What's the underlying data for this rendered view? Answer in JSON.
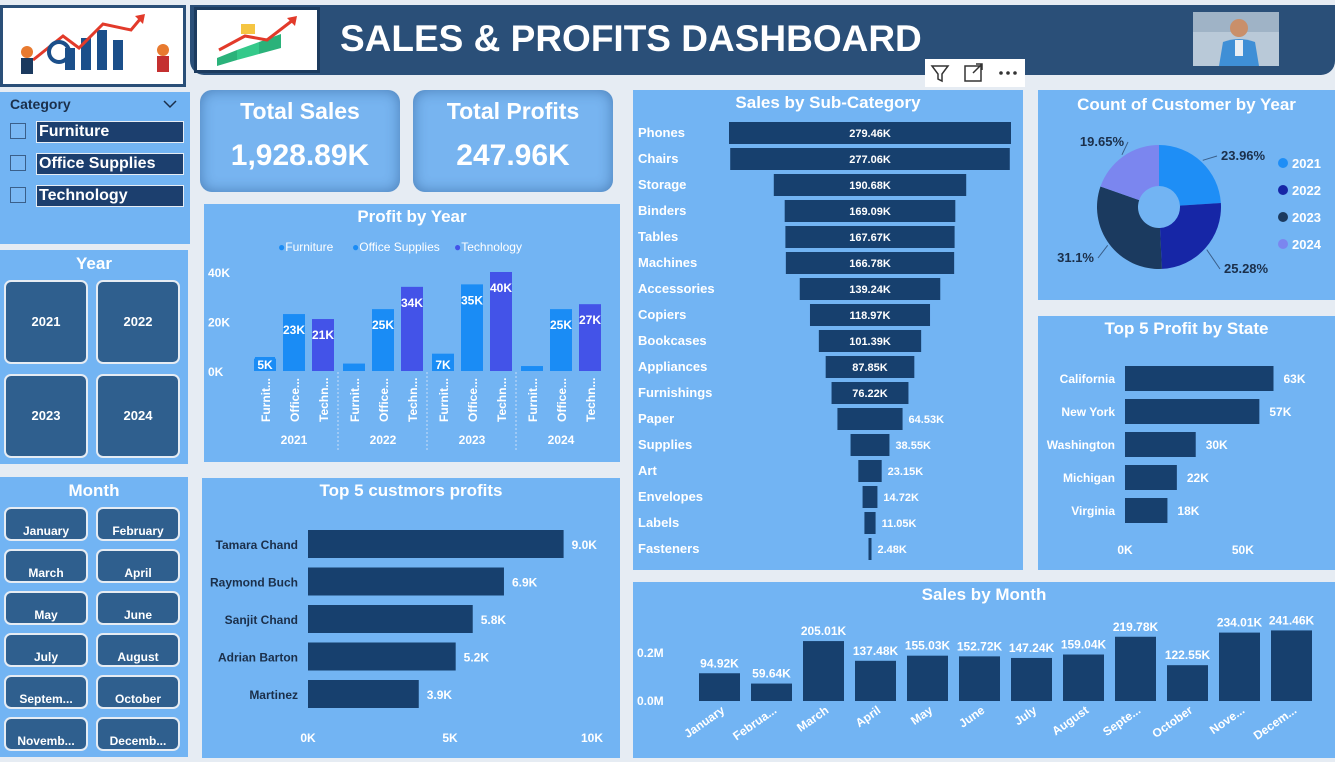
{
  "header": {
    "title": "SALES & PROFITS DASHBOARD"
  },
  "toolbar": {
    "filter_icon": "filter-icon",
    "focus_icon": "focus-mode-icon",
    "more_icon": "more-options-icon"
  },
  "category_slicer": {
    "title": "Category",
    "items": [
      "Furniture",
      "Office Supplies",
      "Technology"
    ]
  },
  "year_slicer": {
    "title": "Year",
    "items": [
      "2021",
      "2022",
      "2023",
      "2024"
    ]
  },
  "month_slicer": {
    "title": "Month",
    "items": [
      "January",
      "February",
      "March",
      "April",
      "May",
      "June",
      "July",
      "August",
      "Septem...",
      "October",
      "Novemb...",
      "Decemb..."
    ]
  },
  "kpis": {
    "total_sales_label": "Total Sales",
    "total_sales_value": "1,928.89K",
    "total_profits_label": "Total Profits",
    "total_profits_value": "247.96K"
  },
  "colors": {
    "panel_bg": "#72b4f3",
    "header_bg": "#2a4f78",
    "dark_bar": "#17406e",
    "furniture": "#1a8cf5",
    "office_supplies": "#1a8cf5",
    "technology": "#4353e8",
    "pie_2021": "#1e8ef6",
    "pie_2022": "#1626a6",
    "pie_2023": "#1b3a5f",
    "pie_2024": "#7b86ef"
  },
  "chart_data": [
    {
      "id": "profit_by_year",
      "type": "bar",
      "title": "Profit by Year",
      "legend": [
        "Furniture",
        "Office Supplies",
        "Technology"
      ],
      "legend_position": "top",
      "groups": [
        "2021",
        "2022",
        "2023",
        "2024"
      ],
      "categories": [
        "Furnit...",
        "Office...",
        "Techn..."
      ],
      "series": [
        {
          "name": "Furniture",
          "values": [
            5000,
            3000,
            7000,
            2000
          ],
          "labels": [
            "5K",
            "",
            "7K",
            ""
          ]
        },
        {
          "name": "Office Supplies",
          "values": [
            23000,
            25000,
            35000,
            25000
          ],
          "labels": [
            "23K",
            "25K",
            "35K",
            "25K"
          ]
        },
        {
          "name": "Technology",
          "values": [
            21000,
            34000,
            40000,
            27000
          ],
          "labels": [
            "21K",
            "34K",
            "40K",
            "27K"
          ]
        }
      ],
      "yticks": [
        "0K",
        "20K",
        "40K"
      ],
      "ylim": [
        0,
        40000
      ]
    },
    {
      "id": "sales_by_subcategory",
      "type": "bar",
      "title": "Sales by Sub-Category",
      "categories": [
        "Phones",
        "Chairs",
        "Storage",
        "Binders",
        "Tables",
        "Machines",
        "Accessories",
        "Copiers",
        "Bookcases",
        "Appliances",
        "Furnishings",
        "Paper",
        "Supplies",
        "Art",
        "Envelopes",
        "Labels",
        "Fasteners"
      ],
      "values": [
        279.46,
        277.06,
        190.68,
        169.09,
        167.67,
        166.78,
        139.24,
        118.97,
        101.39,
        87.85,
        76.22,
        64.53,
        38.55,
        23.15,
        14.72,
        11.05,
        2.48
      ],
      "labels": [
        "279.46K",
        "277.06K",
        "190.68K",
        "169.09K",
        "167.67K",
        "166.78K",
        "139.24K",
        "118.97K",
        "101.39K",
        "87.85K",
        "76.22K",
        "64.53K",
        "38.55K",
        "23.15K",
        "14.72K",
        "11.05K",
        "2.48K"
      ]
    },
    {
      "id": "customer_count_by_year",
      "type": "pie",
      "title": "Count of Customer by Year",
      "categories": [
        "2021",
        "2022",
        "2023",
        "2024"
      ],
      "values": [
        23.96,
        25.28,
        31.1,
        19.65
      ],
      "labels": [
        "23.96%",
        "25.28%",
        "31.1%",
        "19.65%"
      ],
      "legend_position": "right"
    },
    {
      "id": "top5_profit_by_state",
      "type": "bar",
      "title": "Top 5 Profit by State",
      "categories": [
        "California",
        "New York",
        "Washington",
        "Michigan",
        "Virginia"
      ],
      "values": [
        63,
        57,
        30,
        22,
        18
      ],
      "labels": [
        "63K",
        "57K",
        "30K",
        "22K",
        "18K"
      ],
      "xticks": [
        "0K",
        "50K"
      ],
      "xlim": [
        0,
        70
      ]
    },
    {
      "id": "top5_customers_profits",
      "type": "bar",
      "title": "Top 5 custmors profits",
      "categories": [
        "Tamara Chand",
        "Raymond Buch",
        "Sanjit Chand",
        "Adrian Barton",
        "Martinez"
      ],
      "values": [
        9.0,
        6.9,
        5.8,
        5.2,
        3.9
      ],
      "labels": [
        "9.0K",
        "6.9K",
        "5.8K",
        "5.2K",
        "3.9K"
      ],
      "xticks": [
        "0K",
        "5K",
        "10K"
      ],
      "xlim": [
        0,
        10
      ]
    },
    {
      "id": "sales_by_month",
      "type": "bar",
      "title": "Sales by Month",
      "categories": [
        "January",
        "Februa...",
        "March",
        "April",
        "May",
        "June",
        "July",
        "August",
        "Septe...",
        "October",
        "Nove...",
        "Decem..."
      ],
      "values": [
        94.92,
        59.64,
        205.01,
        137.48,
        155.03,
        152.72,
        147.24,
        159.04,
        219.78,
        122.55,
        234.01,
        241.46
      ],
      "labels": [
        "94.92K",
        "59.64K",
        "205.01K",
        "137.48K",
        "155.03K",
        "152.72K",
        "147.24K",
        "159.04K",
        "219.78K",
        "122.55K",
        "234.01K",
        "241.46K"
      ],
      "yticks": [
        "0.0M",
        "0.2M"
      ],
      "ylim": [
        0,
        260
      ]
    }
  ]
}
